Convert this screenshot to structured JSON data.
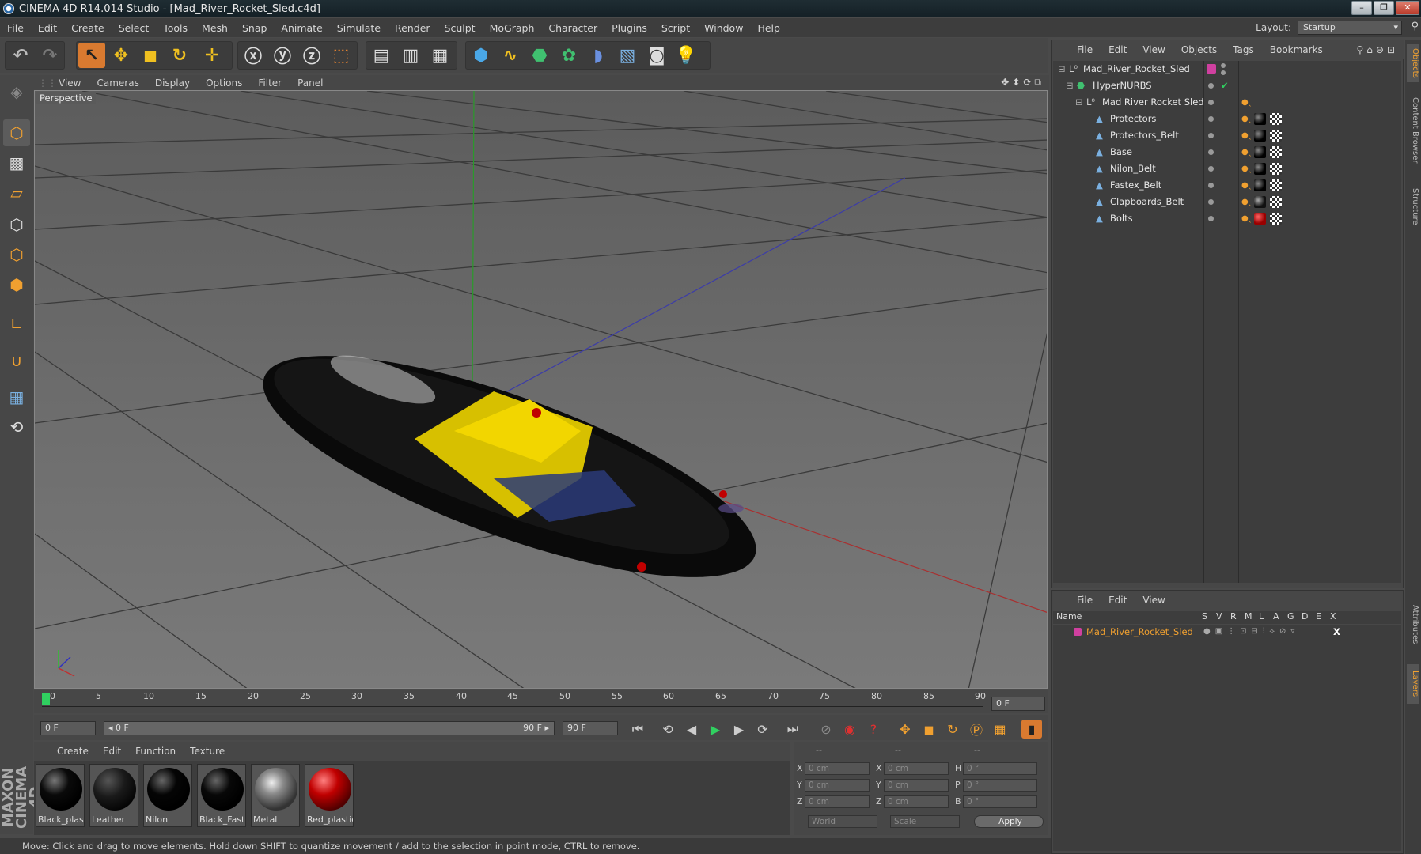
{
  "window": {
    "title": "CINEMA 4D R14.014 Studio - [Mad_River_Rocket_Sled.c4d]",
    "min": "–",
    "max": "❐",
    "close": "✕"
  },
  "menubar": {
    "items": [
      "File",
      "Edit",
      "Create",
      "Select",
      "Tools",
      "Mesh",
      "Snap",
      "Animate",
      "Simulate",
      "Render",
      "Sculpt",
      "MoGraph",
      "Character",
      "Plugins",
      "Script",
      "Window",
      "Help"
    ],
    "layout_label": "Layout:",
    "layout_value": "Startup"
  },
  "viewport": {
    "menu": [
      "View",
      "Cameras",
      "Display",
      "Options",
      "Filter",
      "Panel"
    ],
    "label": "Perspective"
  },
  "timeline": {
    "ticks": [
      "0",
      "5",
      "10",
      "15",
      "20",
      "25",
      "30",
      "35",
      "40",
      "45",
      "50",
      "55",
      "60",
      "65",
      "70",
      "75",
      "80",
      "85",
      "90"
    ],
    "current_frame": "0 F"
  },
  "playbar": {
    "start": "0 F",
    "range_start": "◂ 0 F",
    "range_end": "90 F ▸",
    "end": "90 F"
  },
  "materials": {
    "menu": [
      "Create",
      "Edit",
      "Function",
      "Texture"
    ],
    "items": [
      {
        "name": "Black_plast",
        "color": "#0a0a0a"
      },
      {
        "name": "Leather",
        "color": "#1a1a1a"
      },
      {
        "name": "Nilon",
        "color": "#050505"
      },
      {
        "name": "Black_Faste",
        "color": "#080808"
      },
      {
        "name": "Metal",
        "color": "#8a8a8a"
      },
      {
        "name": "Red_plastic",
        "color": "#c00000"
      }
    ]
  },
  "coordinates": {
    "header": [
      "--",
      "--",
      "--"
    ],
    "rows": [
      {
        "a": "X",
        "av": "0 cm",
        "b": "X",
        "bv": "0 cm",
        "c": "H",
        "cv": "0 °"
      },
      {
        "a": "Y",
        "av": "0 cm",
        "b": "Y",
        "bv": "0 cm",
        "c": "P",
        "cv": "0 °"
      },
      {
        "a": "Z",
        "av": "0 cm",
        "b": "Z",
        "bv": "0 cm",
        "c": "B",
        "cv": "0 °"
      }
    ],
    "mode1": "World",
    "mode2": "Scale",
    "apply": "Apply"
  },
  "status": "Move: Click and drag to move elements. Hold down SHIFT to quantize movement / add to the selection in point mode, CTRL to remove.",
  "brand": "MAXON CINEMA 4D",
  "object_manager": {
    "menu": [
      "File",
      "Edit",
      "View",
      "Objects",
      "Tags",
      "Bookmarks"
    ],
    "objects": [
      {
        "name": "Mad_River_Rocket_Sled",
        "indent": 0
      },
      {
        "name": "HyperNURBS",
        "indent": 1
      },
      {
        "name": "Mad River Rocket Sled",
        "indent": 2
      },
      {
        "name": "Protectors",
        "indent": 3
      },
      {
        "name": "Protectors_Belt",
        "indent": 3
      },
      {
        "name": "Base",
        "indent": 3
      },
      {
        "name": "Nilon_Belt",
        "indent": 3
      },
      {
        "name": "Fastex_Belt",
        "indent": 3
      },
      {
        "name": "Clapboards_Belt",
        "indent": 3
      },
      {
        "name": "Bolts",
        "indent": 3
      }
    ]
  },
  "layer_manager": {
    "menu": [
      "File",
      "Edit",
      "View"
    ],
    "columns": [
      "Name",
      "S",
      "V",
      "R",
      "M",
      "L",
      "A",
      "G",
      "D",
      "E",
      "X"
    ],
    "layers": [
      {
        "name": "Mad_River_Rocket_Sled",
        "color": "#d040a0"
      }
    ]
  },
  "side_tabs": [
    "Objects",
    "Content Browser",
    "Structure",
    "Attributes",
    "Layers"
  ]
}
